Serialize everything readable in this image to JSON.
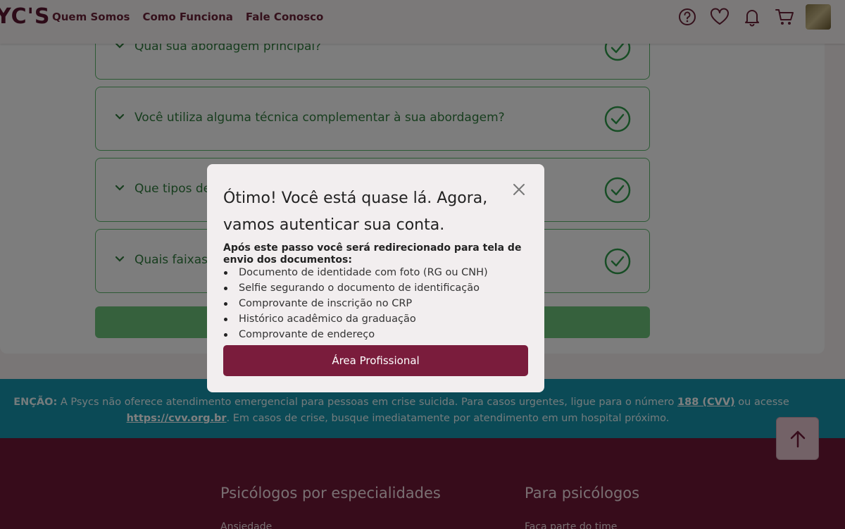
{
  "header": {
    "logo": "YC'S",
    "nav": [
      "Quem Somos",
      "Como Funciona",
      "Fale Conosco"
    ],
    "icons": [
      "help-icon",
      "heart-icon",
      "bell-icon",
      "cart-icon"
    ]
  },
  "questions": [
    "Qual sua abordagem principal?",
    "Você utiliza alguma técnica complementar à sua abordagem?",
    "Que tipos de",
    "Quais faixas"
  ],
  "warning": {
    "prefix": "ENÇÃO:",
    "text1": " A Psycs não oferece atendimento emergencial para pessoas em crise suicida. Para casos urgentes, ligue para o número ",
    "cvv_number": "188 (CVV)",
    "text2": " ou acesse",
    "cvv_url": "https://cvv.org.br",
    "text3": ". Em casos de crise, busque imediatamente por atendimento em um hospital próximo."
  },
  "footer": {
    "col1_title": "Psicólogos por especialidades",
    "col1_item": "Ansiedade",
    "col2_title": "Para psicólogos",
    "col2_item": "Faça parte do time"
  },
  "modal": {
    "title": "Ótimo! Você está quase lá. Agora, vamos autenticar sua conta.",
    "intro": "Após este passo você será redirecionado para tela de envio dos documentos:",
    "documents": [
      "Documento de identidade com foto (RG ou CNH)",
      "Selfie segurando o documento de identificação",
      "Comprovante de inscrição no CRP",
      "Histórico acadêmico da graduação",
      "Comprovante de endereço"
    ],
    "button": "Área Profissional"
  },
  "colors": {
    "brand": "#7a1c3c",
    "success": "#5ab56a",
    "warning_band": "#1695ad"
  }
}
